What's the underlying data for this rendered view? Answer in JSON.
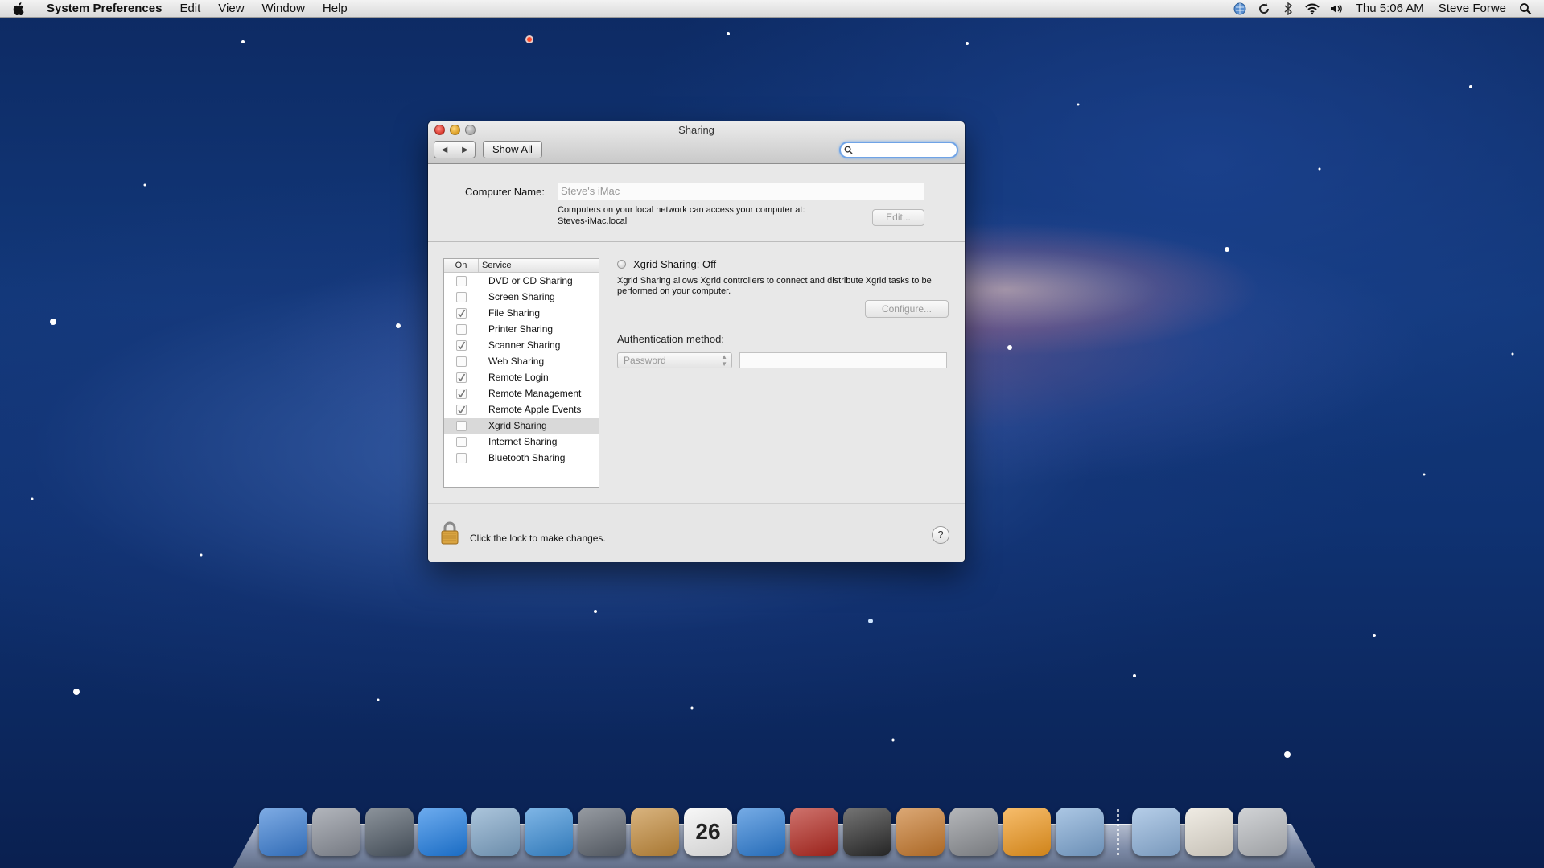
{
  "menubar": {
    "app_name": "System Preferences",
    "items": [
      "Edit",
      "View",
      "Window",
      "Help"
    ],
    "clock": "Thu 5:06 AM",
    "user": "Steve Forwe"
  },
  "window": {
    "title": "Sharing",
    "show_all": "Show All",
    "search_placeholder": "",
    "computer_name_label": "Computer Name:",
    "computer_name_value": "Steve's iMac",
    "address_info_line1": "Computers on your local network can access your computer at:",
    "address_info_line2": "Steves-iMac.local",
    "edit_button": "Edit...",
    "services_header_on": "On",
    "services_header_service": "Service",
    "services": [
      {
        "label": "DVD or CD Sharing",
        "checked": false
      },
      {
        "label": "Screen Sharing",
        "checked": false
      },
      {
        "label": "File Sharing",
        "checked": true
      },
      {
        "label": "Printer Sharing",
        "checked": false
      },
      {
        "label": "Scanner Sharing",
        "checked": true
      },
      {
        "label": "Web Sharing",
        "checked": false
      },
      {
        "label": "Remote Login",
        "checked": true
      },
      {
        "label": "Remote Management",
        "checked": true
      },
      {
        "label": "Remote Apple Events",
        "checked": true
      },
      {
        "label": "Xgrid Sharing",
        "checked": false,
        "selected": true
      },
      {
        "label": "Internet Sharing",
        "checked": false
      },
      {
        "label": "Bluetooth Sharing",
        "checked": false
      }
    ],
    "detail": {
      "status_title": "Xgrid Sharing: Off",
      "description": "Xgrid Sharing allows Xgrid controllers to connect and distribute Xgrid tasks to be performed on your computer.",
      "configure_button": "Configure...",
      "auth_label": "Authentication method:",
      "auth_value": "Password"
    },
    "lock_text": "Click the lock to make changes.",
    "help": "?"
  },
  "dock": {
    "apps": [
      {
        "name": "finder",
        "color": "#3a7fd6"
      },
      {
        "name": "launchpad",
        "color": "#8a8f99"
      },
      {
        "name": "photo-browser",
        "color": "#4f5a66"
      },
      {
        "name": "app-store",
        "color": "#1f7fe6"
      },
      {
        "name": "preview",
        "color": "#7fa6c9"
      },
      {
        "name": "safari",
        "color": "#3b8fd9"
      },
      {
        "name": "facetime",
        "color": "#5f6670"
      },
      {
        "name": "address-book",
        "color": "#c58c3b"
      },
      {
        "name": "ical",
        "color": "#f4f4f4",
        "label": "26"
      },
      {
        "name": "itunes",
        "color": "#2d7fd8"
      },
      {
        "name": "photo-booth",
        "color": "#b5281f"
      },
      {
        "name": "printer",
        "color": "#2b2b2b"
      },
      {
        "name": "iphoto",
        "color": "#c97a2c"
      },
      {
        "name": "system-preferences",
        "color": "#8d9095"
      },
      {
        "name": "vlingo",
        "color": "#f39a1e"
      },
      {
        "name": "hp-utility",
        "color": "#7fa9d6"
      },
      {
        "name": "applications-folder",
        "color": "#8fb4dd"
      },
      {
        "name": "documents-stack",
        "color": "#e8e2d6"
      },
      {
        "name": "trash",
        "color": "#b9bcc0"
      }
    ]
  }
}
